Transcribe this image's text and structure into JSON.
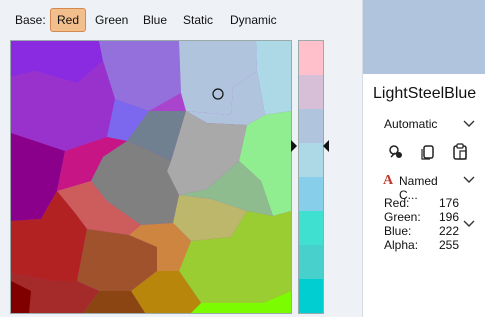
{
  "toolbar": {
    "base_label": "Base:",
    "tabs": [
      {
        "label": "Red",
        "active": true
      },
      {
        "label": "Green",
        "active": false
      },
      {
        "label": "Blue",
        "active": false
      },
      {
        "label": "Static",
        "active": false
      },
      {
        "label": "Dynamic",
        "active": false
      }
    ]
  },
  "color_panel": {
    "swatch_color": "#b0c4de",
    "color_name": "LightSteelBlue",
    "mode": "Automatic",
    "named_label": "Named C...",
    "rgba": [
      {
        "key": "Red:",
        "value": "176"
      },
      {
        "key": "Green:",
        "value": "196"
      },
      {
        "key": "Blue:",
        "value": "222"
      },
      {
        "key": "Alpha:",
        "value": "255"
      }
    ]
  },
  "strip_colors": [
    "#ffc0cb",
    "#d8bfd8",
    "#b0c4de",
    "#add8e6",
    "#87ceeb",
    "#40e0d0",
    "#48d1cc",
    "#00ced1"
  ],
  "icons": {
    "eyedropper": "eyedropper-icon",
    "copy": "copy-icon",
    "paste": "paste-icon",
    "chevron": "chevron-down-icon",
    "named": "text-a-icon"
  }
}
